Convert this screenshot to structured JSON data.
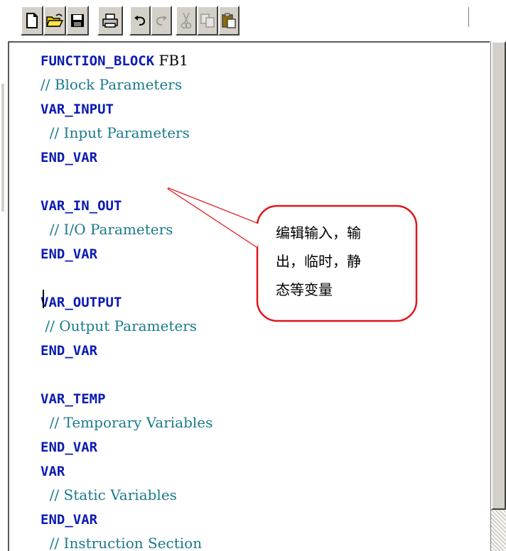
{
  "toolbar": {
    "buttons": [
      {
        "icon": "new-document-icon",
        "enabled": true
      },
      {
        "icon": "open-folder-icon",
        "enabled": true
      },
      {
        "icon": "save-disk-icon",
        "enabled": true
      },
      {
        "icon": "print-icon",
        "enabled": true
      },
      {
        "icon": "undo-icon",
        "enabled": true
      },
      {
        "icon": "redo-icon",
        "enabled": false
      },
      {
        "icon": "cut-icon",
        "enabled": false
      },
      {
        "icon": "copy-icon",
        "enabled": false
      },
      {
        "icon": "paste-icon",
        "enabled": true
      }
    ]
  },
  "editor": {
    "lines": [
      {
        "kw": "FUNCTION_BLOCK",
        "text": " FB1"
      },
      {
        "comment": "// Block Parameters"
      },
      {
        "kw": "VAR_INPUT"
      },
      {
        "comment": "  // Input Parameters"
      },
      {
        "kw": "END_VAR"
      },
      {},
      {
        "kw": "VAR_IN_OUT"
      },
      {
        "comment": "  // I/O Parameters"
      },
      {
        "kw": "END_VAR"
      },
      {},
      {
        "kw": "VAR_OUTPUT"
      },
      {
        "comment": " // Output Parameters"
      },
      {
        "kw": "END_VAR"
      },
      {},
      {
        "kw": "VAR_TEMP"
      },
      {
        "comment": "  // Temporary Variables"
      },
      {
        "kw": "END_VAR"
      },
      {
        "kw": "VAR"
      },
      {
        "comment": "  // Static Variables"
      },
      {
        "kw": "END_VAR"
      },
      {
        "comment": "  // Instruction Section"
      }
    ]
  },
  "callout": {
    "text": "编辑输入，输\n出，临时，静\n态等变量",
    "border_color": "#e0161b"
  },
  "colors": {
    "keyword": "#0b1bb3",
    "comment": "#1a7a8c",
    "chrome": "#d4d0c8"
  }
}
